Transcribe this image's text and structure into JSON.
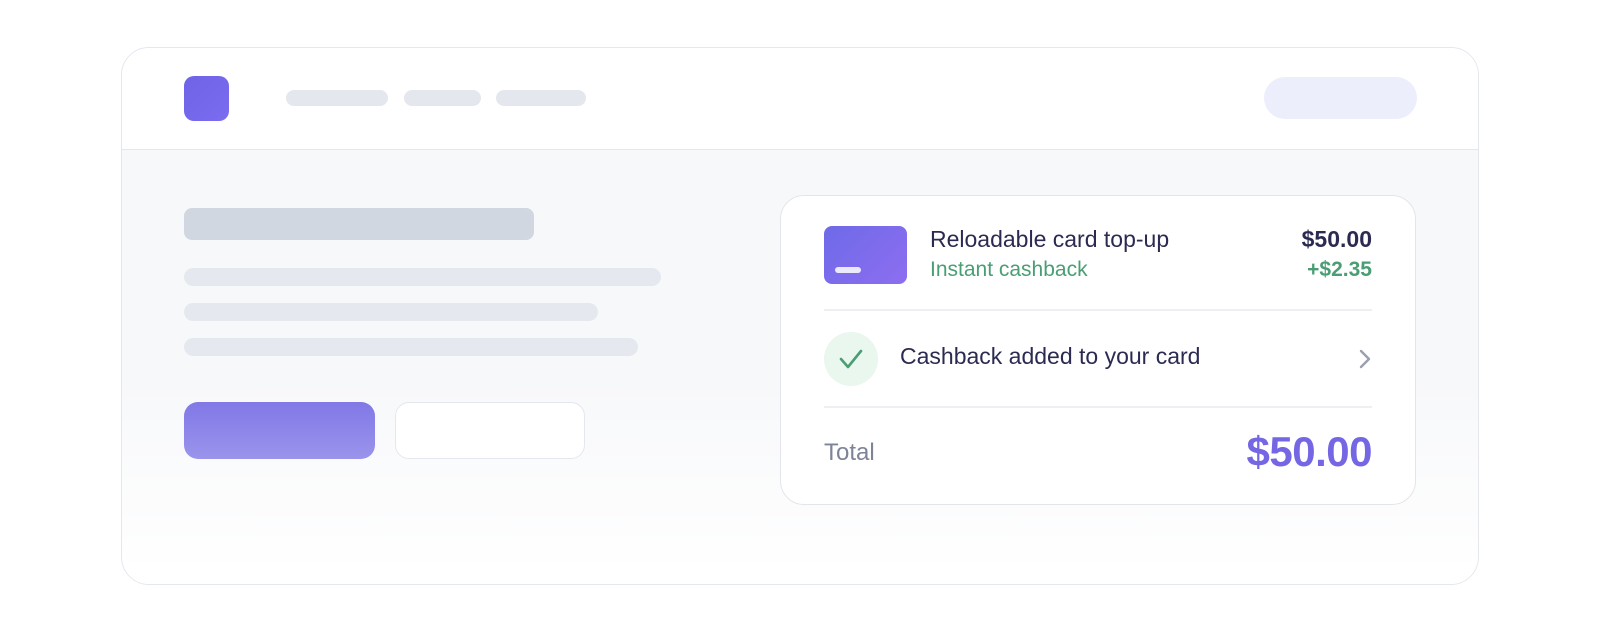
{
  "header": {
    "logo_icon": "app-logo-square",
    "nav_placeholders": 3,
    "action_placeholder": true
  },
  "order_card": {
    "item": {
      "icon": "card-icon",
      "title": "Reloadable card top-up",
      "subtitle": "Instant cashback",
      "price": "$50.00",
      "cashback": "+$2.35"
    },
    "status": {
      "icon": "check-icon",
      "text": "Cashback added to your card",
      "chevron_icon": "chevron-right-icon"
    },
    "total": {
      "label": "Total",
      "value": "$50.00"
    }
  },
  "colors": {
    "accent": "#7566e4",
    "success": "#4a9e74",
    "text_primary": "#2b2b52",
    "text_muted": "#7e8497"
  }
}
